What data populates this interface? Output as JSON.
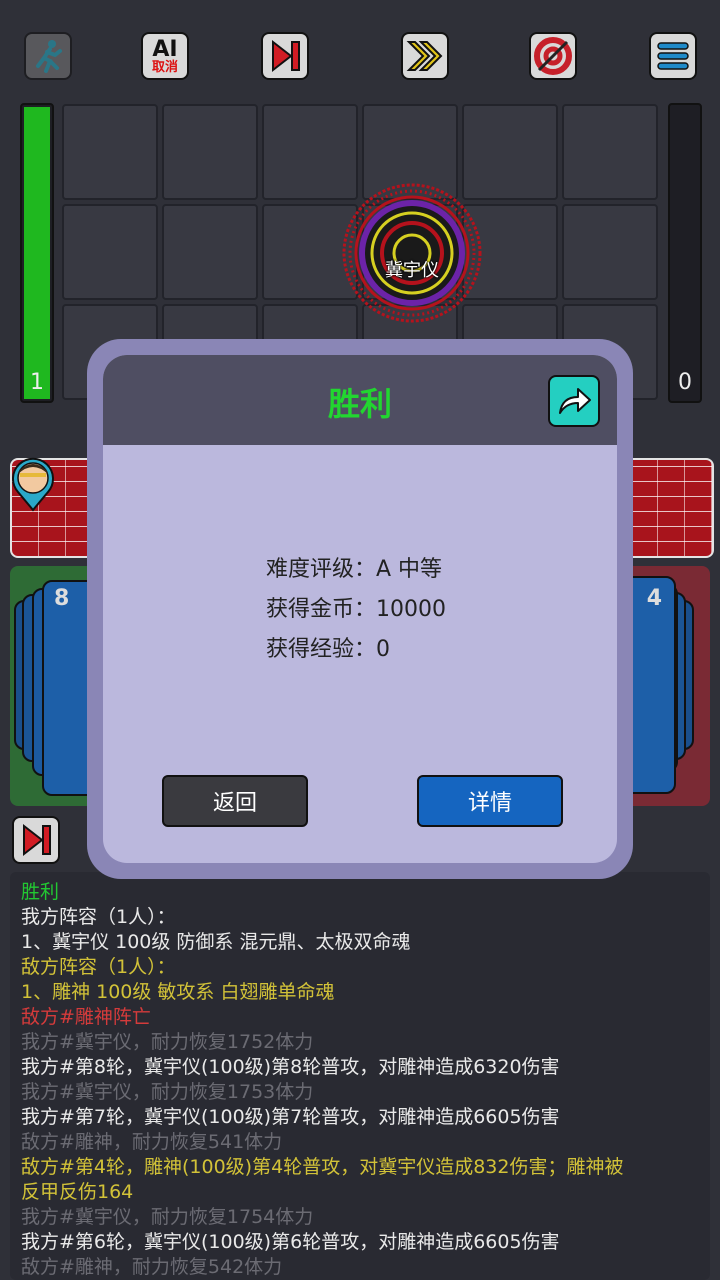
{
  "toolbar": {
    "ai_line1": "AI",
    "ai_line2": "取消"
  },
  "battlefield": {
    "left_hp_value": "1",
    "right_hp_value": "0",
    "left_hp_fraction": 1.0,
    "right_hp_fraction": 0.0,
    "unit_name": "冀宇仪"
  },
  "decks": {
    "left_count": "8",
    "right_count": "4"
  },
  "dialog": {
    "title": "胜利",
    "stats": [
      "难度评级：A 中等",
      "获得金币：10000",
      "获得经验：0"
    ],
    "back_label": "返回",
    "details_label": "详情"
  },
  "log": [
    {
      "text": "胜利",
      "color": "green"
    },
    {
      "text": "我方阵容（1人）：",
      "color": "white"
    },
    {
      "text": "1、冀宇仪 100级 防御系 混元鼎、太极双命魂",
      "color": "white"
    },
    {
      "text": "敌方阵容（1人）：",
      "color": "yellow"
    },
    {
      "text": "1、雕神 100级 敏攻系 白翅雕单命魂",
      "color": "yellow"
    },
    {
      "text": "敌方#雕神阵亡",
      "color": "red"
    },
    {
      "text": "我方#冀宇仪，耐力恢复1752体力",
      "color": "gray"
    },
    {
      "text": "我方#第8轮，冀宇仪(100级)第8轮普攻，对雕神造成6320伤害",
      "color": "white"
    },
    {
      "text": "我方#冀宇仪，耐力恢复1753体力",
      "color": "gray"
    },
    {
      "text": "我方#第7轮，冀宇仪(100级)第7轮普攻，对雕神造成6605伤害",
      "color": "white"
    },
    {
      "text": "敌方#雕神，耐力恢复541体力",
      "color": "gray"
    },
    {
      "text": "敌方#第4轮，雕神(100级)第4轮普攻，对冀宇仪造成832伤害；雕神被",
      "color": "yellow"
    },
    {
      "text": "反甲反伤164",
      "color": "yellow"
    },
    {
      "text": "我方#冀宇仪，耐力恢复1754体力",
      "color": "gray"
    },
    {
      "text": "我方#第6轮，冀宇仪(100级)第6轮普攻，对雕神造成6605伤害",
      "color": "white"
    },
    {
      "text": "敌方#雕神，耐力恢复542体力",
      "color": "gray"
    }
  ],
  "colors": {
    "victory_green": "#22d630",
    "hp_green": "#1fb81f",
    "details_blue": "#1565c0",
    "dialog_bg": "#bbb8dd"
  },
  "icons": [
    "running-man-icon",
    "ai-cancel-icon",
    "skip-icon",
    "fast-forward-icon",
    "target-icon",
    "menu-icon",
    "share-icon",
    "player-avatar-icon"
  ]
}
